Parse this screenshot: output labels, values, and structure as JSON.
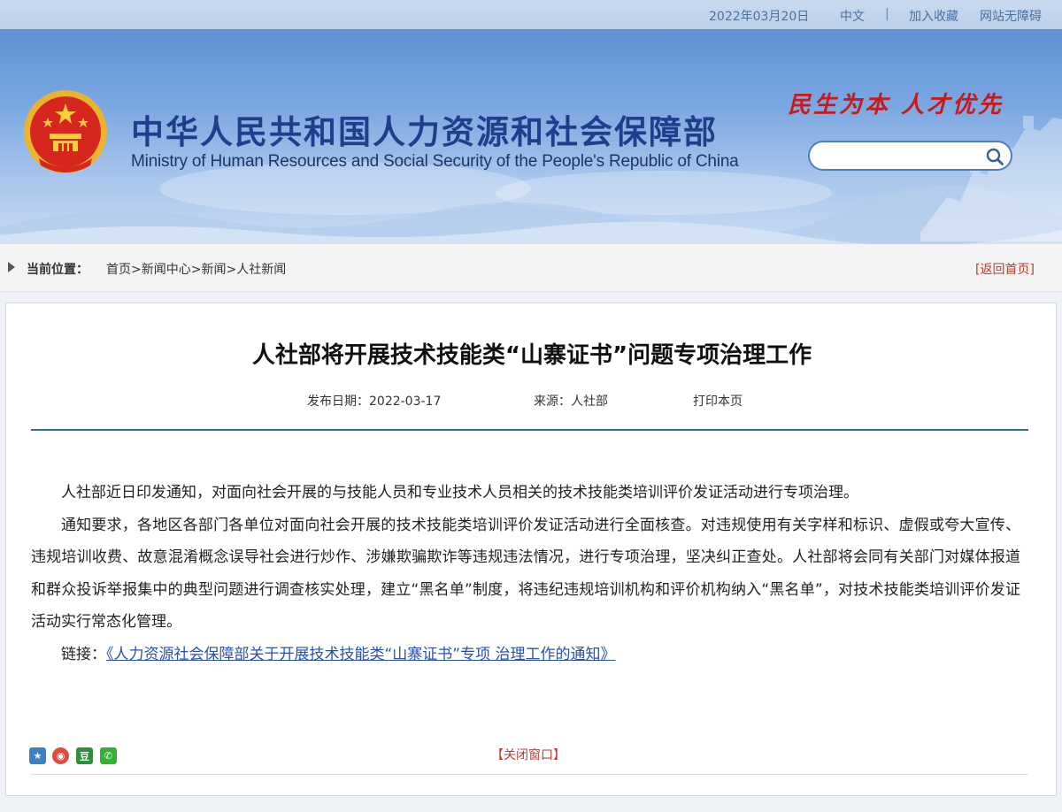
{
  "topbar": {
    "date": "2022年03月20日",
    "lang": "中文",
    "separator": "|",
    "favorite": "加入收藏",
    "accessibility": "网站无障碍"
  },
  "header": {
    "title_cn": "中华人民共和国人力资源和社会保障部",
    "title_en": "Ministry of Human Resources and Social Security of the People's Republic of China",
    "slogan": "民生为本  人才优先",
    "search_placeholder": "",
    "emblem_icon": "national-emblem-icon",
    "colors": {
      "banner": "#7aa7e1",
      "title": "#1f3f8c",
      "slogan": "#c81a1a"
    }
  },
  "breadcrumb": {
    "label": "当前位置：",
    "items": [
      "首页",
      "新闻中心",
      "新闻",
      "人社新闻"
    ],
    "separator": ">",
    "back_home": "[返回首页]"
  },
  "article": {
    "title": "人社部将开展技术技能类“山寨证书”问题专项治理工作",
    "publish_date": "发布日期：2022-03-17",
    "source": "来源：人社部",
    "print": "打印本页",
    "paragraphs": [
      "人社部近日印发通知，对面向社会开展的与技能人员和专业技术人员相关的技术技能类培训评价发证活动进行专项治理。",
      "通知要求，各地区各部门各单位对面向社会开展的技术技能类培训评价发证活动进行全面核查。对违规使用有关字样和标识、虚假或夸大宣传、违规培训收费、故意混淆概念误导社会进行炒作、涉嫌欺骗欺诈等违规违法情况，进行专项治理，坚决纠正查处。人社部将会同有关部门对媒体报道和群众投诉举报集中的典型问题进行调查核实处理，建立“黑名单”制度，将违纪违规培训机构和评价机构纳入“黑名单”，对技术技能类培训评价发证活动实行常态化管理。"
    ],
    "link_label": "链接：",
    "link_text": "《人力资源社会保障部关于开展技术技能类“山寨证书”专项 治理工作的通知》",
    "close_window": "【关闭窗口】",
    "share_icons": [
      "qzone-icon",
      "weibo-icon",
      "douban-icon",
      "wechat-icon"
    ],
    "share_glyphs": [
      "★",
      "◉",
      "豆",
      "✆"
    ],
    "link_color": "#2a4fae"
  }
}
